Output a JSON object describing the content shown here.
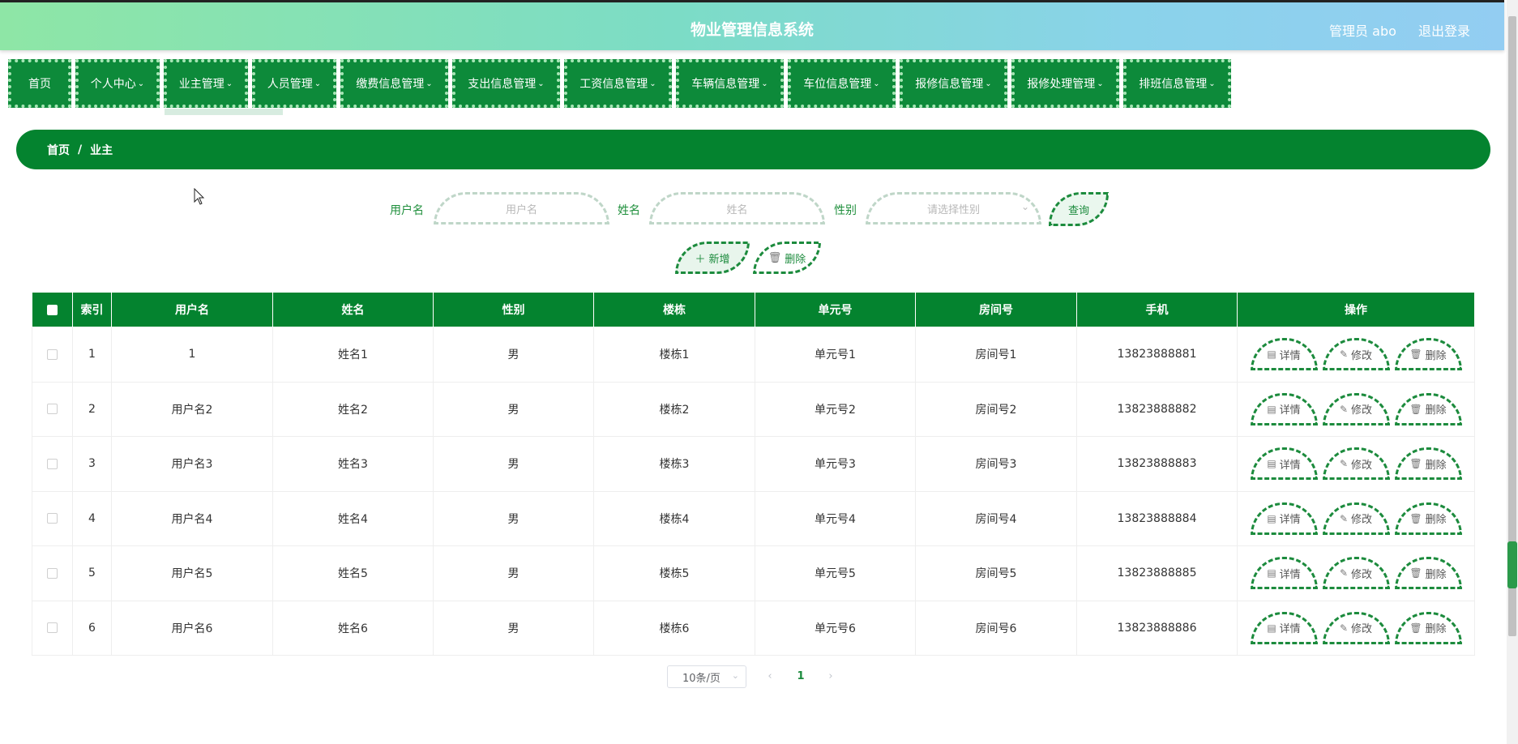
{
  "header": {
    "title": "物业管理信息系统",
    "user": "管理员 abo",
    "logout": "退出登录"
  },
  "nav": [
    {
      "label": "首页",
      "dropdown": false
    },
    {
      "label": "个人中心",
      "dropdown": true
    },
    {
      "label": "业主管理",
      "dropdown": true
    },
    {
      "label": "人员管理",
      "dropdown": true
    },
    {
      "label": "缴费信息管理",
      "dropdown": true
    },
    {
      "label": "支出信息管理",
      "dropdown": true
    },
    {
      "label": "工资信息管理",
      "dropdown": true
    },
    {
      "label": "车辆信息管理",
      "dropdown": true
    },
    {
      "label": "车位信息管理",
      "dropdown": true
    },
    {
      "label": "报修信息管理",
      "dropdown": true
    },
    {
      "label": "报修处理管理",
      "dropdown": true
    },
    {
      "label": "排班信息管理",
      "dropdown": true
    }
  ],
  "breadcrumb": {
    "home": "首页",
    "sep": "/",
    "current": "业主"
  },
  "search": {
    "username_label": "用户名",
    "username_placeholder": "用户名",
    "name_label": "姓名",
    "name_placeholder": "姓名",
    "gender_label": "性别",
    "gender_placeholder": "请选择性别",
    "query": "查询"
  },
  "actions": {
    "add": "新增",
    "delete": "删除"
  },
  "table": {
    "headers": [
      "索引",
      "用户名",
      "姓名",
      "性别",
      "楼栋",
      "单元号",
      "房间号",
      "手机",
      "操作"
    ],
    "rows": [
      [
        "1",
        "1",
        "姓名1",
        "男",
        "楼栋1",
        "单元号1",
        "房间号1",
        "13823888881"
      ],
      [
        "2",
        "用户名2",
        "姓名2",
        "男",
        "楼栋2",
        "单元号2",
        "房间号2",
        "13823888882"
      ],
      [
        "3",
        "用户名3",
        "姓名3",
        "男",
        "楼栋3",
        "单元号3",
        "房间号3",
        "13823888883"
      ],
      [
        "4",
        "用户名4",
        "姓名4",
        "男",
        "楼栋4",
        "单元号4",
        "房间号4",
        "13823888884"
      ],
      [
        "5",
        "用户名5",
        "姓名5",
        "男",
        "楼栋5",
        "单元号5",
        "房间号5",
        "13823888885"
      ],
      [
        "6",
        "用户名6",
        "姓名6",
        "男",
        "楼栋6",
        "单元号6",
        "房间号6",
        "13823888886"
      ]
    ],
    "row_actions": {
      "detail": "详情",
      "edit": "修改",
      "delete": "删除"
    }
  },
  "pagination": {
    "page_size": "10条/页",
    "prev": "‹",
    "current": "1",
    "next": "›"
  }
}
